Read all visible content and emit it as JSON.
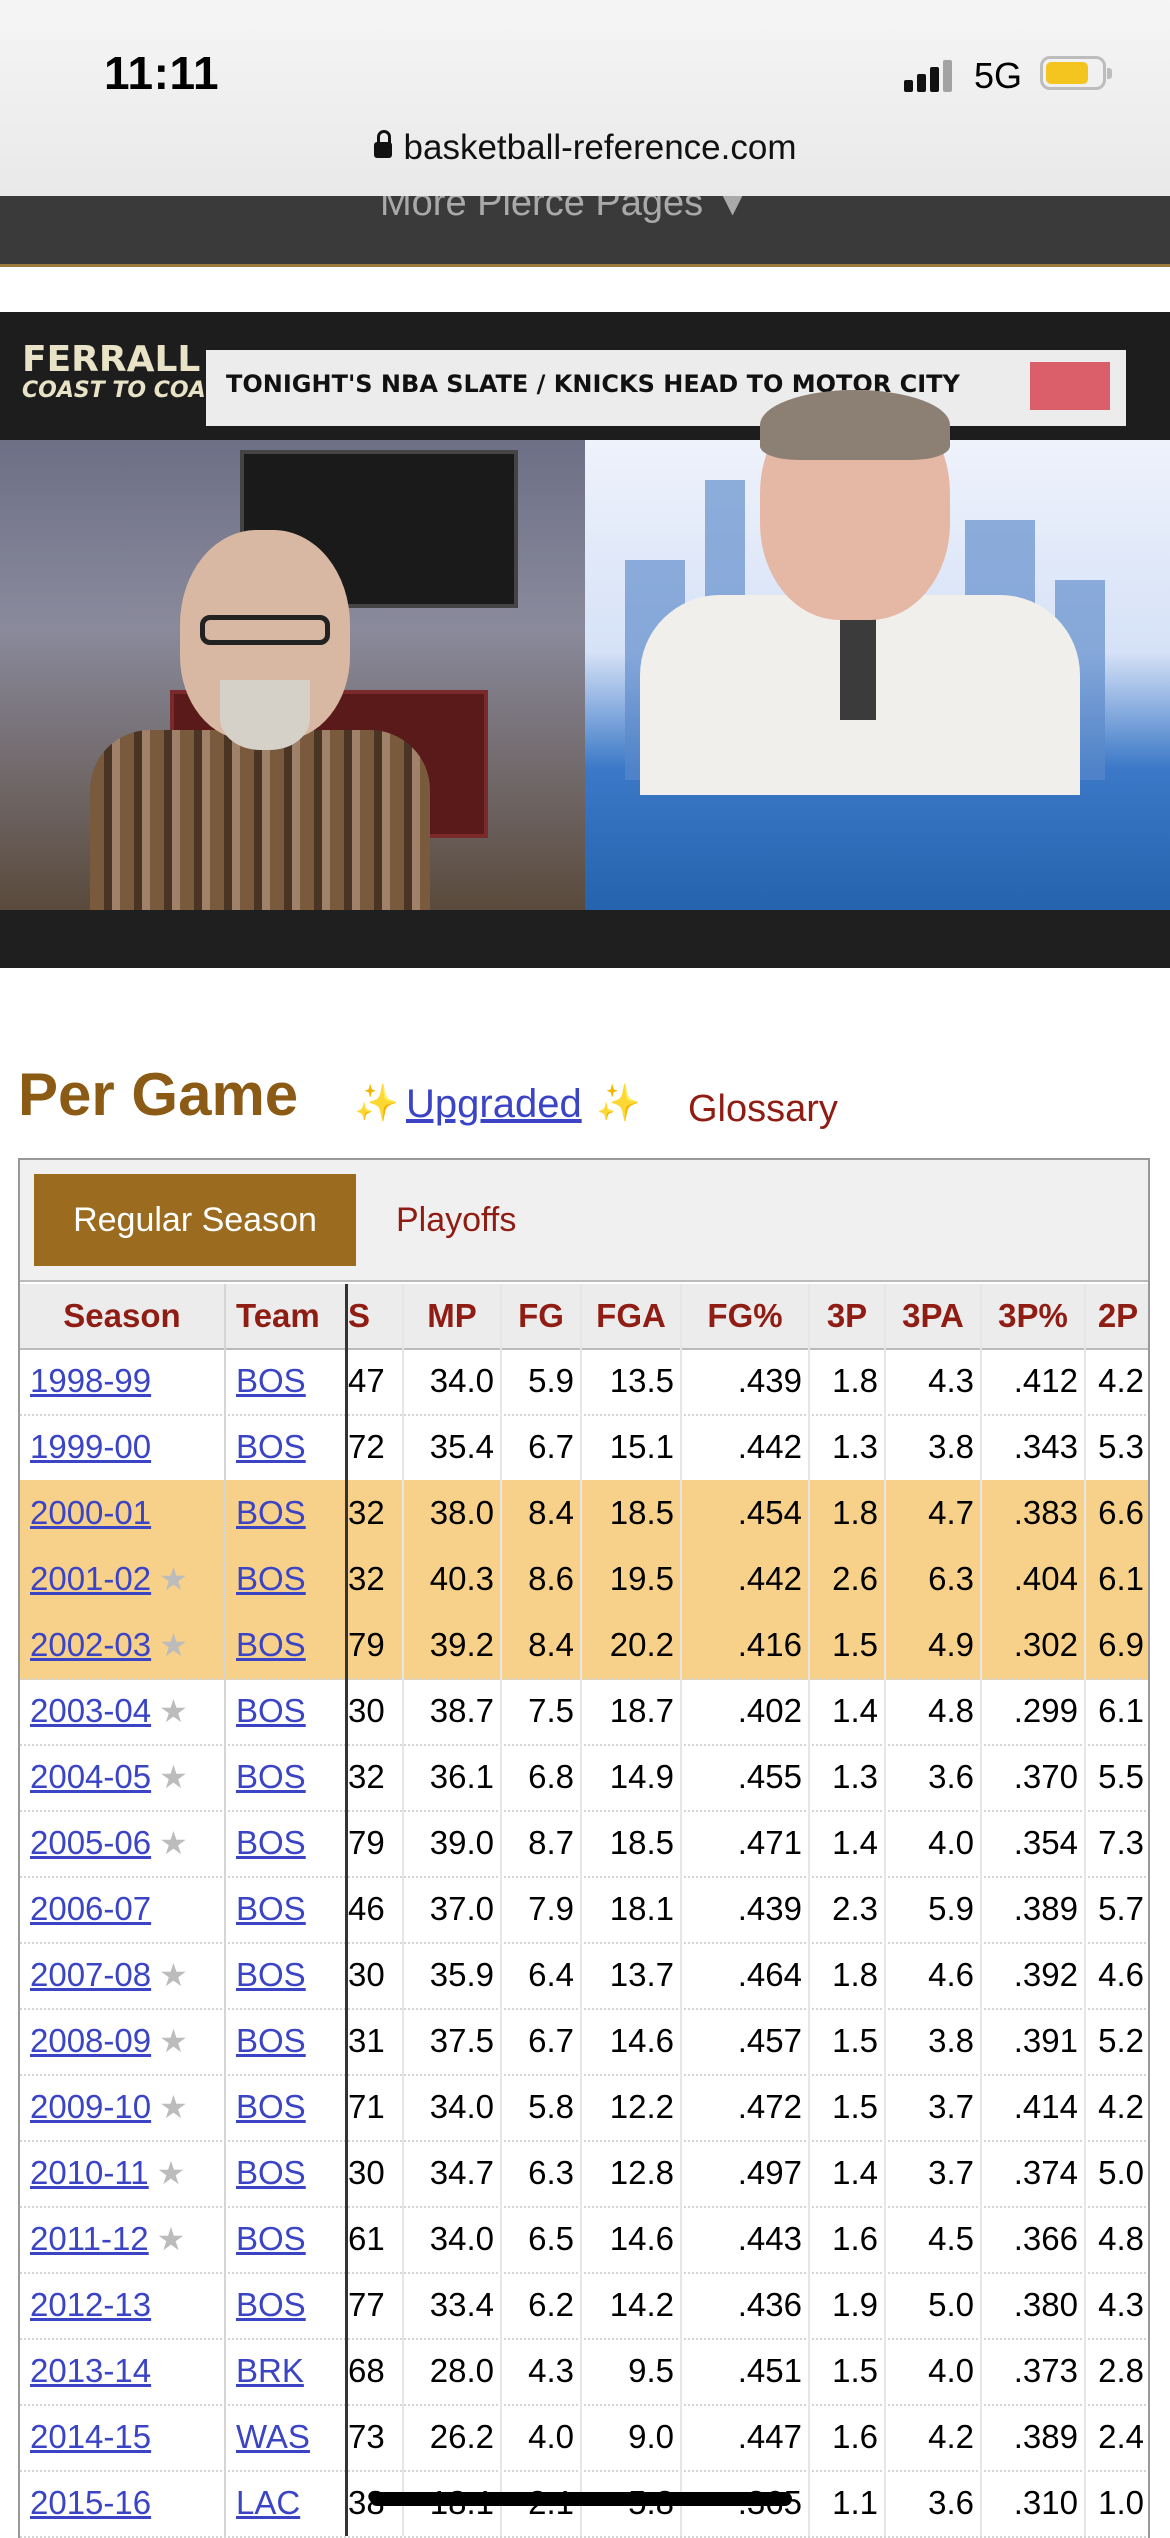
{
  "status": {
    "time": "11:11",
    "network": "5G",
    "battery_level": 0.78,
    "battery_color": "#f4c51f"
  },
  "browser": {
    "url": "basketball-reference.com"
  },
  "nav": {
    "partial_text": "More Pierce Pages ▼"
  },
  "video": {
    "logo_line1": "FERRALL",
    "logo_line2": "COAST TO COAST",
    "banner_text": "TONIGHT'S NBA SLATE / KNICKS HEAD TO MOTOR CITY"
  },
  "section": {
    "title": "Per Game",
    "upgraded_label": "Upgraded",
    "glossary_label": "Glossary"
  },
  "tabs": {
    "regular_season": "Regular Season",
    "playoffs": "Playoffs"
  },
  "table": {
    "headers": {
      "season": "Season",
      "team": "Team",
      "gs": "S",
      "mp": "MP",
      "fg": "FG",
      "fga": "FGA",
      "fgp": "FG%",
      "tp": "3P",
      "tpa": "3PA",
      "tpp": "3P%",
      "twop": "2P"
    },
    "rows": [
      {
        "season": "1998-99",
        "team": "BOS",
        "gs": "47",
        "mp": "34.0",
        "fg": "5.9",
        "fga": "13.5",
        "fgp": ".439",
        "tp": "1.8",
        "tpa": "4.3",
        "tpp": ".412",
        "twop": "4.2",
        "star": false,
        "hl": false
      },
      {
        "season": "1999-00",
        "team": "BOS",
        "gs": "72",
        "mp": "35.4",
        "fg": "6.7",
        "fga": "15.1",
        "fgp": ".442",
        "tp": "1.3",
        "tpa": "3.8",
        "tpp": ".343",
        "twop": "5.3",
        "star": false,
        "hl": false
      },
      {
        "season": "2000-01",
        "team": "BOS",
        "gs": "32",
        "mp": "38.0",
        "fg": "8.4",
        "fga": "18.5",
        "fgp": ".454",
        "tp": "1.8",
        "tpa": "4.7",
        "tpp": ".383",
        "twop": "6.6",
        "star": false,
        "hl": true
      },
      {
        "season": "2001-02",
        "team": "BOS",
        "gs": "32",
        "mp": "40.3",
        "fg": "8.6",
        "fga": "19.5",
        "fgp": ".442",
        "tp": "2.6",
        "tpa": "6.3",
        "tpp": ".404",
        "twop": "6.1",
        "star": true,
        "hl": true
      },
      {
        "season": "2002-03",
        "team": "BOS",
        "gs": "79",
        "mp": "39.2",
        "fg": "8.4",
        "fga": "20.2",
        "fgp": ".416",
        "tp": "1.5",
        "tpa": "4.9",
        "tpp": ".302",
        "twop": "6.9",
        "star": true,
        "hl": true
      },
      {
        "season": "2003-04",
        "team": "BOS",
        "gs": "30",
        "mp": "38.7",
        "fg": "7.5",
        "fga": "18.7",
        "fgp": ".402",
        "tp": "1.4",
        "tpa": "4.8",
        "tpp": ".299",
        "twop": "6.1",
        "star": true,
        "hl": false
      },
      {
        "season": "2004-05",
        "team": "BOS",
        "gs": "32",
        "mp": "36.1",
        "fg": "6.8",
        "fga": "14.9",
        "fgp": ".455",
        "tp": "1.3",
        "tpa": "3.6",
        "tpp": ".370",
        "twop": "5.5",
        "star": true,
        "hl": false
      },
      {
        "season": "2005-06",
        "team": "BOS",
        "gs": "79",
        "mp": "39.0",
        "fg": "8.7",
        "fga": "18.5",
        "fgp": ".471",
        "tp": "1.4",
        "tpa": "4.0",
        "tpp": ".354",
        "twop": "7.3",
        "star": true,
        "hl": false
      },
      {
        "season": "2006-07",
        "team": "BOS",
        "gs": "46",
        "mp": "37.0",
        "fg": "7.9",
        "fga": "18.1",
        "fgp": ".439",
        "tp": "2.3",
        "tpa": "5.9",
        "tpp": ".389",
        "twop": "5.7",
        "star": false,
        "hl": false
      },
      {
        "season": "2007-08",
        "team": "BOS",
        "gs": "30",
        "mp": "35.9",
        "fg": "6.4",
        "fga": "13.7",
        "fgp": ".464",
        "tp": "1.8",
        "tpa": "4.6",
        "tpp": ".392",
        "twop": "4.6",
        "star": true,
        "hl": false
      },
      {
        "season": "2008-09",
        "team": "BOS",
        "gs": "31",
        "mp": "37.5",
        "fg": "6.7",
        "fga": "14.6",
        "fgp": ".457",
        "tp": "1.5",
        "tpa": "3.8",
        "tpp": ".391",
        "twop": "5.2",
        "star": true,
        "hl": false
      },
      {
        "season": "2009-10",
        "team": "BOS",
        "gs": "71",
        "mp": "34.0",
        "fg": "5.8",
        "fga": "12.2",
        "fgp": ".472",
        "tp": "1.5",
        "tpa": "3.7",
        "tpp": ".414",
        "twop": "4.2",
        "star": true,
        "hl": false
      },
      {
        "season": "2010-11",
        "team": "BOS",
        "gs": "30",
        "mp": "34.7",
        "fg": "6.3",
        "fga": "12.8",
        "fgp": ".497",
        "tp": "1.4",
        "tpa": "3.7",
        "tpp": ".374",
        "twop": "5.0",
        "star": true,
        "hl": false
      },
      {
        "season": "2011-12",
        "team": "BOS",
        "gs": "61",
        "mp": "34.0",
        "fg": "6.5",
        "fga": "14.6",
        "fgp": ".443",
        "tp": "1.6",
        "tpa": "4.5",
        "tpp": ".366",
        "twop": "4.8",
        "star": true,
        "hl": false
      },
      {
        "season": "2012-13",
        "team": "BOS",
        "gs": "77",
        "mp": "33.4",
        "fg": "6.2",
        "fga": "14.2",
        "fgp": ".436",
        "tp": "1.9",
        "tpa": "5.0",
        "tpp": ".380",
        "twop": "4.3",
        "star": false,
        "hl": false
      },
      {
        "season": "2013-14",
        "team": "BRK",
        "gs": "68",
        "mp": "28.0",
        "fg": "4.3",
        "fga": "9.5",
        "fgp": ".451",
        "tp": "1.5",
        "tpa": "4.0",
        "tpp": ".373",
        "twop": "2.8",
        "star": false,
        "hl": false
      },
      {
        "season": "2014-15",
        "team": "WAS",
        "gs": "73",
        "mp": "26.2",
        "fg": "4.0",
        "fga": "9.0",
        "fgp": ".447",
        "tp": "1.6",
        "tpa": "4.2",
        "tpp": ".389",
        "twop": "2.4",
        "star": false,
        "hl": false
      },
      {
        "season": "2015-16",
        "team": "LAC",
        "gs": "38",
        "mp": "18.1",
        "fg": "2.1",
        "fga": "5.8",
        "fgp": ".365",
        "tp": "1.1",
        "tpa": "3.6",
        "tpp": ".310",
        "twop": "1.0",
        "star": false,
        "hl": false
      }
    ]
  },
  "colors": {
    "title_brown": "#8b5a14",
    "link_blue": "#3a44c4",
    "header_red": "#8f1d14",
    "tab_active_bg": "#9b6b1f",
    "row_highlight": "#f7d08a"
  }
}
